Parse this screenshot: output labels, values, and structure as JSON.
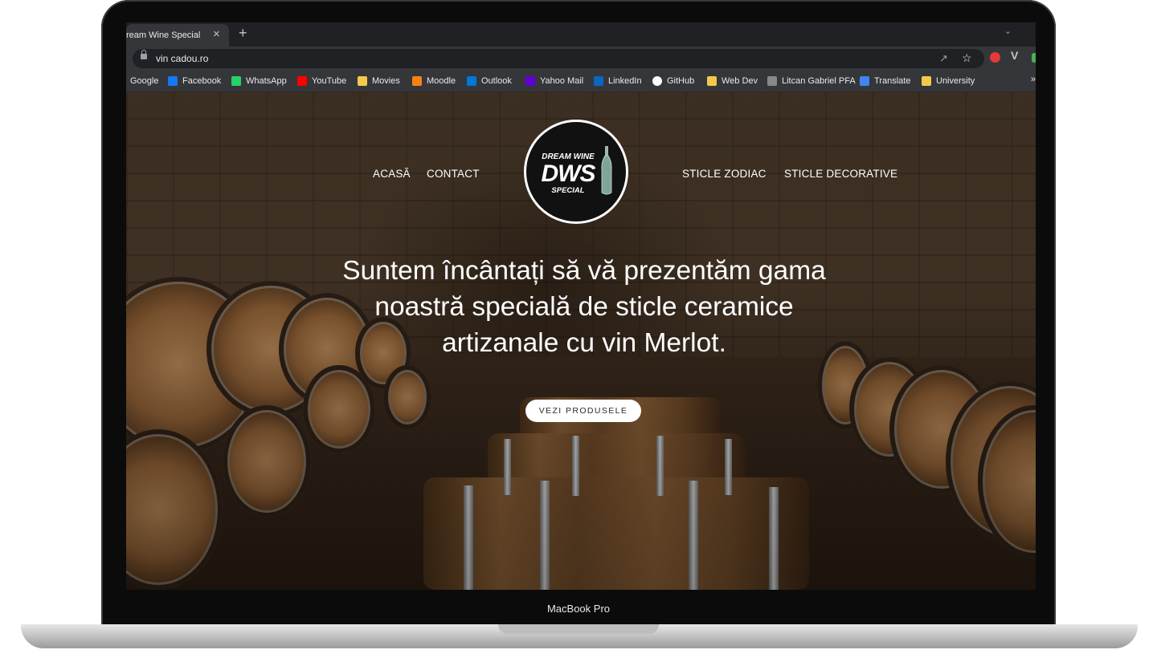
{
  "device": {
    "label": "MacBook Pro"
  },
  "browser": {
    "tab_title": "ream Wine Special",
    "tab_close": "×",
    "new_tab": "+",
    "url": "vin cadou.ro",
    "bookmarks": [
      {
        "label": "Google",
        "icon": "google-icon"
      },
      {
        "label": "Facebook",
        "icon": "facebook-icon",
        "color": "#1877f2"
      },
      {
        "label": "WhatsApp",
        "icon": "whatsapp-icon",
        "color": "#25d366"
      },
      {
        "label": "YouTube",
        "icon": "youtube-icon",
        "color": "#ff0000"
      },
      {
        "label": "Movies",
        "icon": "folder-icon",
        "color": "#f2c94c"
      },
      {
        "label": "Moodle",
        "icon": "moodle-icon",
        "color": "#f98012"
      },
      {
        "label": "Outlook",
        "icon": "outlook-icon",
        "color": "#0078d4"
      },
      {
        "label": "Yahoo Mail",
        "icon": "yahoo-icon",
        "color": "#6001d2"
      },
      {
        "label": "LinkedIn",
        "icon": "linkedin-icon",
        "color": "#0a66c2"
      },
      {
        "label": "GitHub",
        "icon": "github-icon",
        "color": "#ffffff"
      },
      {
        "label": "Web Dev",
        "icon": "folder-icon",
        "color": "#f2c94c"
      },
      {
        "label": "Litcan Gabriel PFA",
        "icon": "page-icon",
        "color": "#888888"
      },
      {
        "label": "Translate",
        "icon": "translate-icon",
        "color": "#4285f4"
      },
      {
        "label": "University",
        "icon": "folder-icon",
        "color": "#f2c94c"
      }
    ],
    "bookmarks_more": "»"
  },
  "site": {
    "nav_left": [
      "ACASĂ",
      "CONTACT"
    ],
    "nav_right": [
      "STICLE ZODIAC",
      "STICLE DECORATIVE"
    ],
    "logo": {
      "top": "DREAM WINE",
      "mono": "DWS",
      "bottom": "SPECIAL"
    },
    "headline": "Suntem încântați să vă prezentăm gama noastră specială de sticle ceramice artizanale cu vin Merlot.",
    "cta": "VEZI PRODUSELE"
  }
}
